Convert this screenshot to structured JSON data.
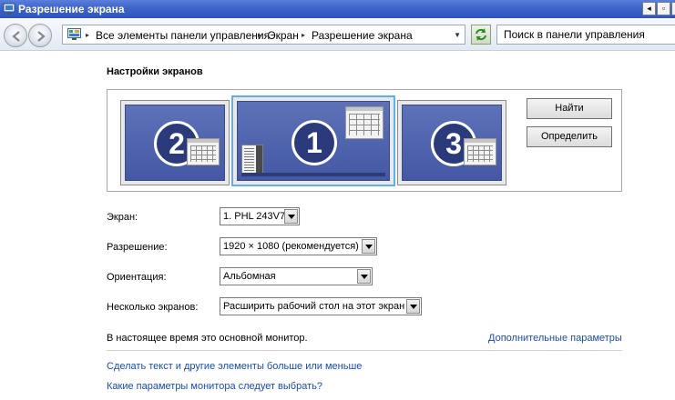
{
  "window": {
    "title": "Разрешение экрана",
    "controls": {
      "restore": "▫",
      "close": "✕",
      "back": "◂"
    }
  },
  "address": {
    "crumbs": [
      "Все элементы панели управления",
      "Экран",
      "Разрешение экрана"
    ],
    "search_placeholder": "Поиск в панели управления"
  },
  "content": {
    "heading": "Настройки экранов",
    "monitors": [
      {
        "number": "2"
      },
      {
        "number": "1",
        "selected": true
      },
      {
        "number": "3"
      }
    ],
    "buttons": {
      "find": "Найти",
      "identify": "Определить"
    },
    "fields": {
      "display": {
        "label": "Экран:",
        "value": "1. PHL 243V7"
      },
      "resolution": {
        "label": "Разрешение:",
        "value": "1920 × 1080 (рекомендуется)"
      },
      "orientation": {
        "label": "Ориентация:",
        "value": "Альбомная"
      },
      "multiple": {
        "label": "Несколько экранов:",
        "value": "Расширить рабочий стол на этот экран"
      }
    },
    "status": "В настоящее время это основной монитор.",
    "advanced_link": "Дополнительные параметры",
    "links": [
      "Сделать текст и другие элементы больше или меньше",
      "Какие параметры монитора следует выбрать?"
    ]
  },
  "colors": {
    "titlebar": "#3d64c8",
    "link": "#1a4bb0",
    "monitor_screen": "#4f63ad",
    "selection": "#5fb0ea"
  }
}
